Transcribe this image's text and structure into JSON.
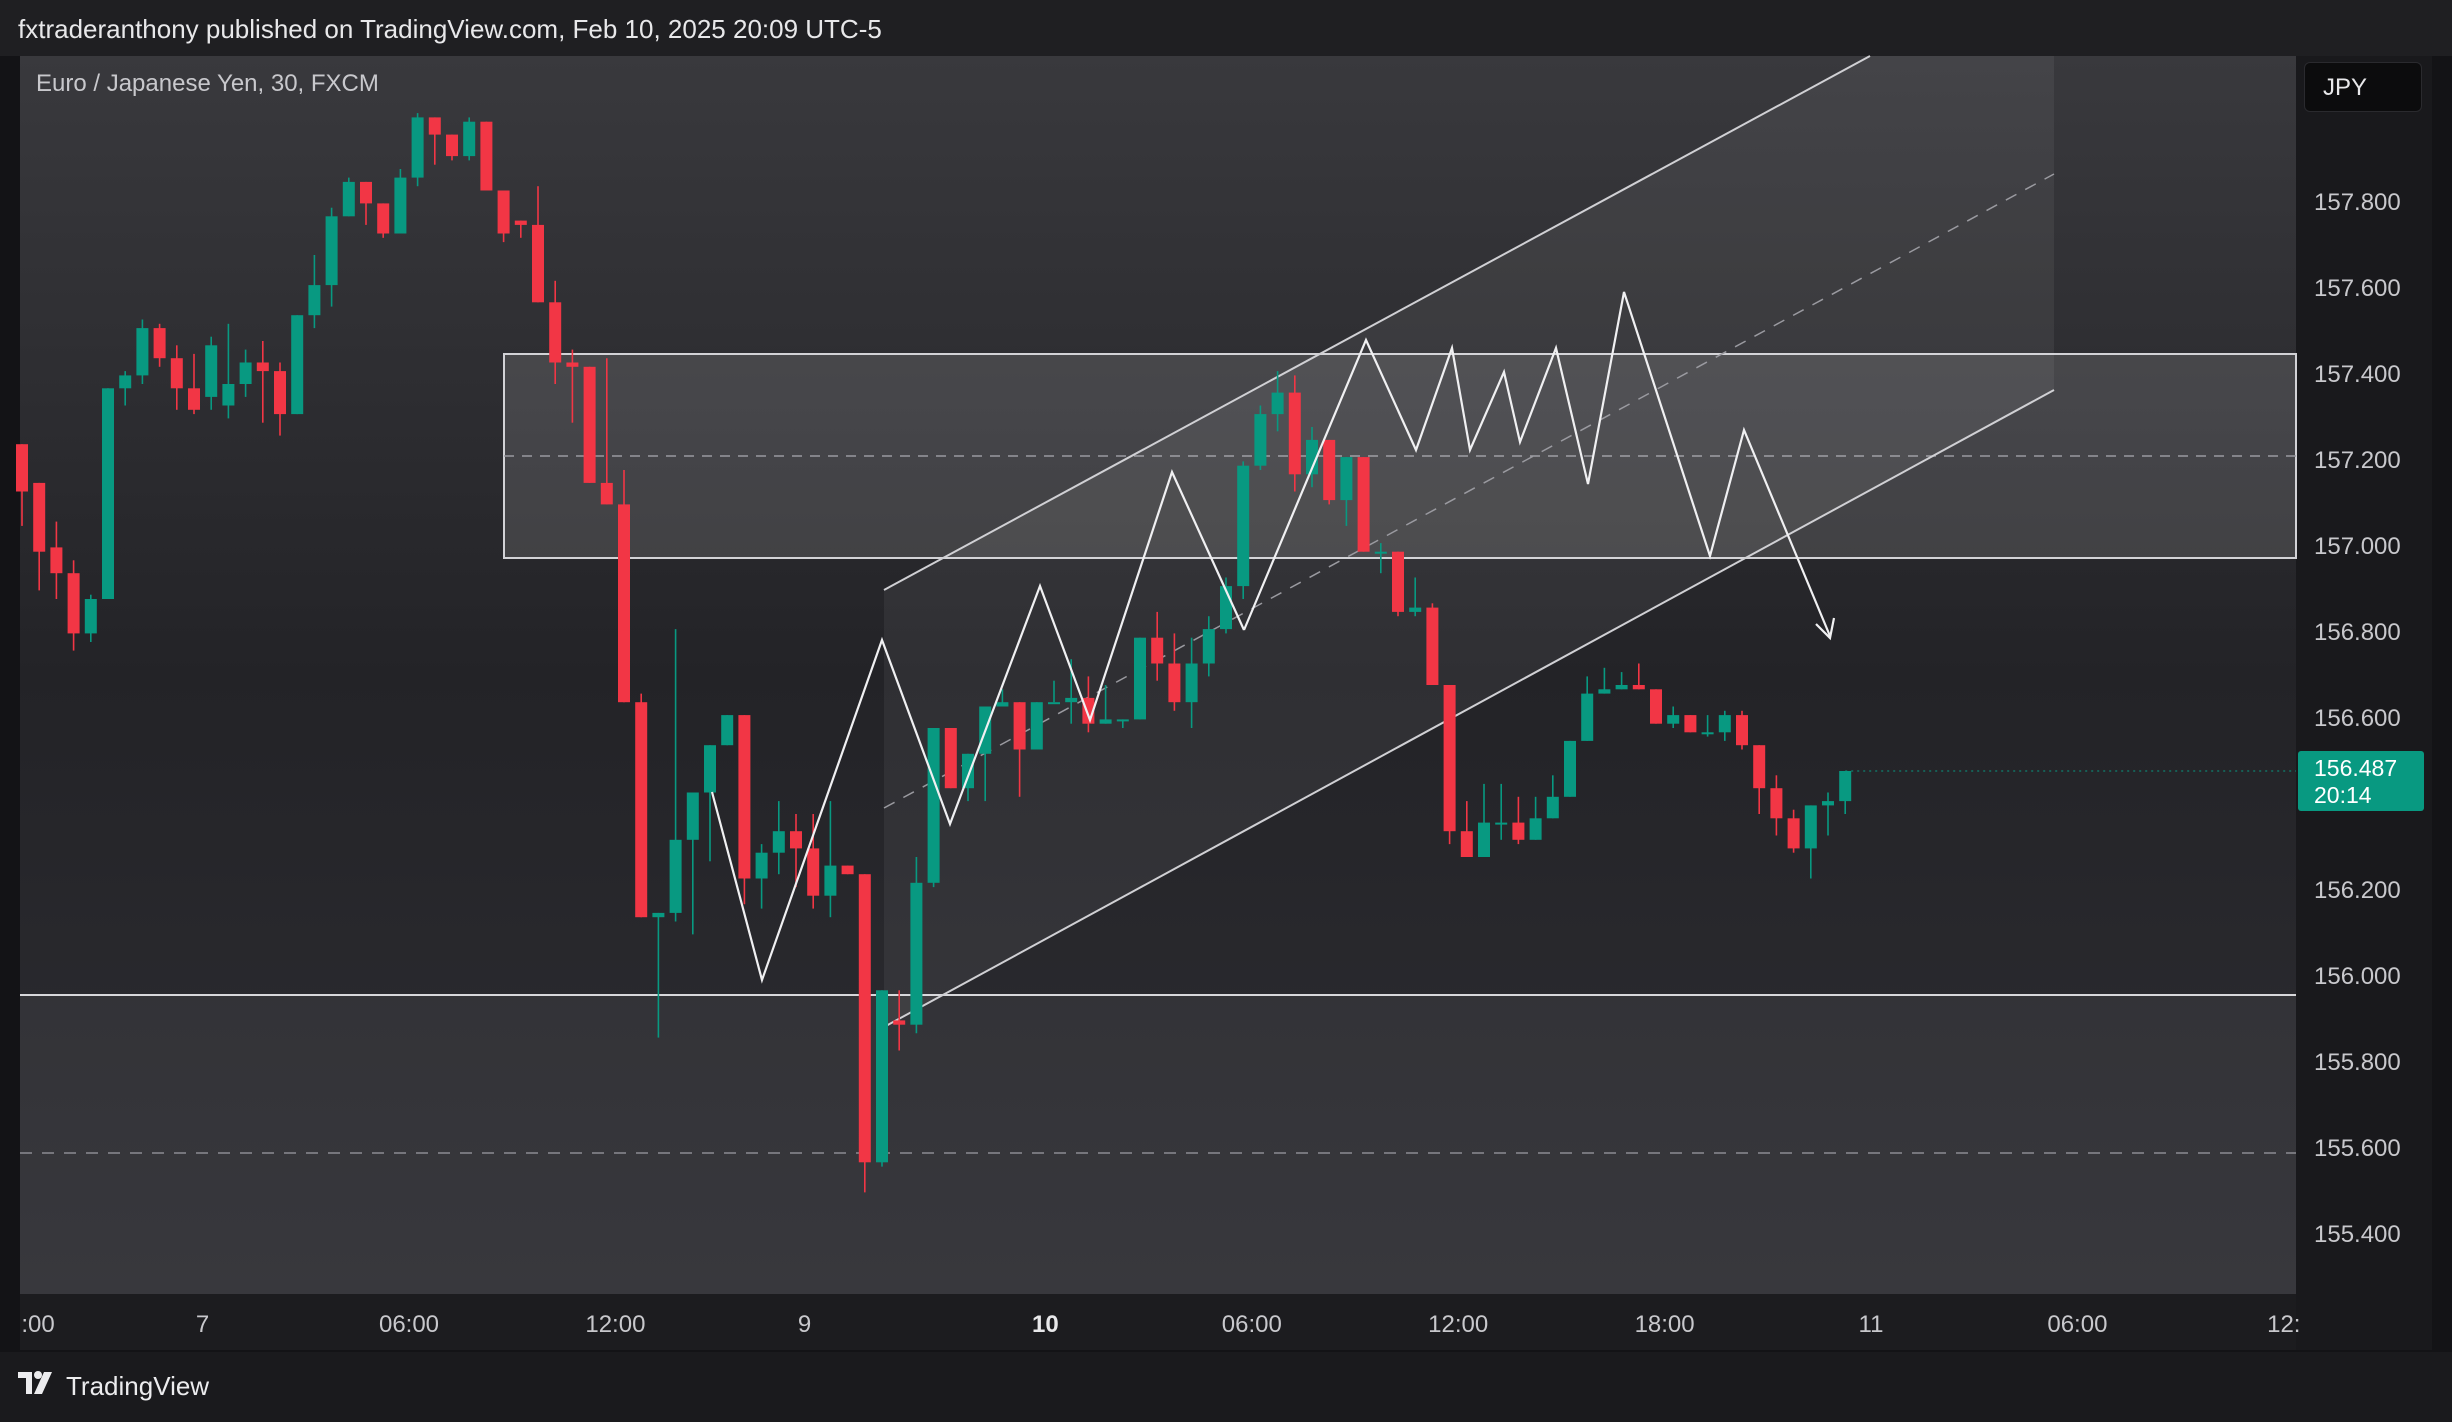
{
  "header": {
    "publisher_text": "fxtraderanthony published on TradingView.com, Feb 10, 2025 20:09 UTC-5"
  },
  "chart": {
    "symbol_title": "Euro / Japanese Yen, 30, FXCM",
    "currency_button": "JPY",
    "last_price": "156.487",
    "countdown": "20:14"
  },
  "footer": {
    "brand": "TradingView"
  },
  "colors": {
    "up": "#089981",
    "down": "#f23645",
    "background": "#131316",
    "pane": "#26262a",
    "drawing": "#e6e6e8"
  },
  "chart_data": {
    "type": "candlestick",
    "title": "Euro / Japanese Yen, 30, FXCM",
    "ylabel": "JPY",
    "ylim": [
      155.25,
      158.1
    ],
    "yticks": [
      "157.800",
      "157.600",
      "157.400",
      "157.200",
      "157.000",
      "156.800",
      "156.600",
      "156.200",
      "156.000",
      "155.800",
      "155.600",
      "155.400"
    ],
    "yticks_hidden_by_labels": [
      "158.000",
      "156.400"
    ],
    "xticks": [
      {
        "label": ":00",
        "bar": -1.5
      },
      {
        "label": "7",
        "bar": 10.5
      },
      {
        "label": "06:00",
        "bar": 22.5
      },
      {
        "label": "12:00",
        "bar": 34.5
      },
      {
        "label": "9",
        "bar": 45.5
      },
      {
        "label": "10",
        "bar": 59.5,
        "bold": true
      },
      {
        "label": "06:00",
        "bar": 71.5
      },
      {
        "label": "12:00",
        "bar": 83.5
      },
      {
        "label": "18:00",
        "bar": 95.5
      },
      {
        "label": "11",
        "bar": 107.5
      },
      {
        "label": "06:00",
        "bar": 119.5
      },
      {
        "label": "12:",
        "bar": 131.5
      }
    ],
    "candles": [
      [
        157.24,
        157.22,
        157.05,
        157.13
      ],
      [
        157.15,
        157.15,
        156.9,
        156.99
      ],
      [
        157.0,
        157.06,
        156.88,
        156.94
      ],
      [
        156.94,
        156.97,
        156.76,
        156.8
      ],
      [
        156.8,
        156.89,
        156.78,
        156.88
      ],
      [
        156.88,
        157.37,
        156.88,
        157.37
      ],
      [
        157.37,
        157.41,
        157.33,
        157.4
      ],
      [
        157.4,
        157.53,
        157.38,
        157.51
      ],
      [
        157.51,
        157.52,
        157.42,
        157.44
      ],
      [
        157.44,
        157.47,
        157.32,
        157.37
      ],
      [
        157.37,
        157.45,
        157.31,
        157.32
      ],
      [
        157.35,
        157.49,
        157.32,
        157.47
      ],
      [
        157.33,
        157.52,
        157.3,
        157.38
      ],
      [
        157.38,
        157.46,
        157.35,
        157.43
      ],
      [
        157.43,
        157.48,
        157.29,
        157.41
      ],
      [
        157.41,
        157.43,
        157.26,
        157.31
      ],
      [
        157.31,
        157.54,
        157.31,
        157.54
      ],
      [
        157.54,
        157.68,
        157.51,
        157.61
      ],
      [
        157.61,
        157.79,
        157.56,
        157.77
      ],
      [
        157.77,
        157.86,
        157.79,
        157.85
      ],
      [
        157.85,
        157.85,
        157.75,
        157.8
      ],
      [
        157.8,
        157.8,
        157.72,
        157.73
      ],
      [
        157.73,
        157.88,
        157.74,
        157.86
      ],
      [
        157.86,
        158.01,
        157.84,
        158.0
      ],
      [
        158.0,
        158.0,
        157.89,
        157.96
      ],
      [
        157.96,
        157.96,
        157.9,
        157.91
      ],
      [
        157.91,
        158.0,
        157.9,
        157.99
      ],
      [
        157.99,
        157.99,
        157.84,
        157.83
      ],
      [
        157.83,
        157.83,
        157.71,
        157.73
      ],
      [
        157.76,
        157.76,
        157.72,
        157.75
      ],
      [
        157.75,
        157.84,
        157.57,
        157.57
      ],
      [
        157.57,
        157.62,
        157.38,
        157.43
      ],
      [
        157.43,
        157.46,
        157.29,
        157.42
      ],
      [
        157.42,
        157.42,
        157.15,
        157.15
      ],
      [
        157.15,
        157.44,
        157.1,
        157.1
      ],
      [
        157.1,
        157.18,
        156.64,
        156.64
      ],
      [
        156.64,
        156.66,
        156.14,
        156.14
      ],
      [
        156.14,
        156.1,
        155.86,
        156.15
      ],
      [
        156.15,
        156.81,
        156.13,
        156.32
      ],
      [
        156.32,
        156.4,
        156.1,
        156.43
      ],
      [
        156.43,
        156.53,
        156.27,
        156.54
      ],
      [
        156.54,
        156.6,
        156.56,
        156.61
      ],
      [
        156.61,
        156.59,
        156.17,
        156.23
      ],
      [
        156.23,
        156.31,
        156.16,
        156.29
      ],
      [
        156.29,
        156.41,
        156.24,
        156.34
      ],
      [
        156.34,
        156.38,
        156.21,
        156.3
      ],
      [
        156.3,
        156.38,
        156.16,
        156.19
      ],
      [
        156.19,
        156.41,
        156.14,
        156.26
      ],
      [
        156.26,
        156.26,
        156.25,
        156.24
      ],
      [
        156.24,
        156.2,
        155.5,
        155.57
      ],
      [
        155.57,
        155.92,
        155.56,
        155.97
      ],
      [
        155.9,
        155.97,
        155.83,
        155.89
      ],
      [
        155.89,
        156.28,
        155.87,
        156.22
      ],
      [
        156.22,
        156.46,
        156.21,
        156.58
      ],
      [
        156.58,
        156.52,
        156.44,
        156.44
      ],
      [
        156.44,
        156.5,
        156.41,
        156.52
      ],
      [
        156.52,
        156.52,
        156.41,
        156.63
      ],
      [
        156.63,
        156.67,
        156.66,
        156.64
      ],
      [
        156.64,
        156.63,
        156.42,
        156.53
      ],
      [
        156.53,
        156.61,
        156.6,
        156.64
      ],
      [
        156.64,
        156.69,
        156.64,
        156.64
      ],
      [
        156.64,
        156.74,
        156.59,
        156.65
      ],
      [
        156.65,
        156.7,
        156.57,
        156.59
      ],
      [
        156.59,
        156.68,
        156.59,
        156.6
      ],
      [
        156.6,
        156.6,
        156.58,
        156.6
      ],
      [
        156.6,
        156.7,
        156.61,
        156.79
      ],
      [
        156.79,
        156.85,
        156.69,
        156.73
      ],
      [
        156.73,
        156.8,
        156.62,
        156.64
      ],
      [
        156.64,
        156.79,
        156.58,
        156.73
      ],
      [
        156.73,
        156.84,
        156.7,
        156.81
      ],
      [
        156.81,
        156.93,
        156.8,
        156.91
      ],
      [
        156.91,
        157.2,
        156.88,
        157.19
      ],
      [
        157.19,
        157.33,
        157.18,
        157.31
      ],
      [
        157.31,
        157.41,
        157.27,
        157.36
      ],
      [
        157.36,
        157.4,
        157.13,
        157.17
      ],
      [
        157.17,
        157.28,
        157.14,
        157.25
      ],
      [
        157.25,
        157.25,
        157.1,
        157.11
      ],
      [
        157.11,
        157.16,
        157.05,
        157.21
      ],
      [
        157.21,
        157.19,
        156.99,
        156.99
      ],
      [
        156.99,
        157.01,
        156.94,
        156.99
      ],
      [
        156.99,
        156.99,
        156.84,
        156.85
      ],
      [
        156.85,
        156.93,
        156.84,
        156.86
      ],
      [
        156.86,
        156.87,
        156.68,
        156.68
      ],
      [
        156.68,
        156.68,
        156.31,
        156.34
      ],
      [
        156.34,
        156.41,
        156.28,
        156.28
      ],
      [
        156.28,
        156.45,
        156.3,
        156.36
      ],
      [
        156.36,
        156.45,
        156.32,
        156.36
      ],
      [
        156.36,
        156.42,
        156.31,
        156.32
      ],
      [
        156.32,
        156.42,
        156.32,
        156.37
      ],
      [
        156.37,
        156.47,
        156.37,
        156.42
      ],
      [
        156.42,
        156.55,
        156.43,
        156.55
      ],
      [
        156.55,
        156.7,
        156.55,
        156.66
      ],
      [
        156.66,
        156.72,
        156.66,
        156.67
      ],
      [
        156.67,
        156.71,
        156.69,
        156.68
      ],
      [
        156.68,
        156.73,
        156.67,
        156.67
      ],
      [
        156.67,
        156.62,
        156.59,
        156.59
      ],
      [
        156.59,
        156.63,
        156.58,
        156.61
      ],
      [
        156.61,
        156.6,
        156.57,
        156.57
      ],
      [
        156.57,
        156.61,
        156.56,
        156.57
      ],
      [
        156.57,
        156.62,
        156.55,
        156.61
      ],
      [
        156.61,
        156.62,
        156.53,
        156.54
      ],
      [
        156.54,
        156.54,
        156.38,
        156.44
      ],
      [
        156.44,
        156.47,
        156.33,
        156.37
      ],
      [
        156.37,
        156.39,
        156.29,
        156.3
      ],
      [
        156.3,
        156.39,
        156.23,
        156.4
      ],
      [
        156.4,
        156.43,
        156.33,
        156.41
      ],
      [
        156.41,
        156.47,
        156.38,
        156.48
      ]
    ]
  }
}
